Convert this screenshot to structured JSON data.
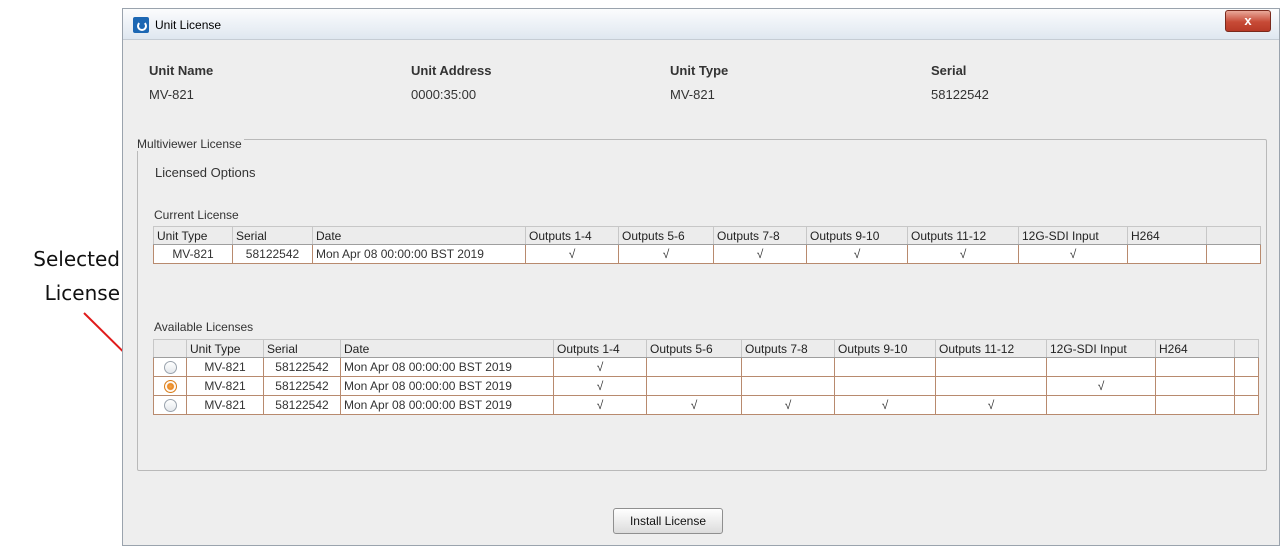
{
  "callout": {
    "line1": "Selected",
    "line2": "License"
  },
  "window": {
    "title": "Unit License",
    "close_label": "x"
  },
  "unit_info": {
    "name_label": "Unit Name",
    "name_value": "MV-821",
    "address_label": "Unit Address",
    "address_value": "0000:35:00",
    "type_label": "Unit Type",
    "type_value": "MV-821",
    "serial_label": "Serial",
    "serial_value": "58122542"
  },
  "multiviewer": {
    "group_label": "Multiviewer License",
    "licensed_options_label": "Licensed Options",
    "current_license_label": "Current License",
    "available_licenses_label": "Available Licenses"
  },
  "current_table": {
    "headers": [
      "Unit Type",
      "Serial",
      "Date",
      "Outputs 1-4",
      "Outputs 5-6",
      "Outputs 7-8",
      "Outputs 9-10",
      "Outputs 11-12",
      "12G-SDI Input",
      "H264",
      ""
    ],
    "rows": [
      [
        "MV-821",
        "58122542",
        "Mon Apr 08 00:00:00 BST 2019",
        "√",
        "√",
        "√",
        "√",
        "√",
        "√",
        "",
        ""
      ]
    ]
  },
  "available_table": {
    "headers": [
      "",
      "Unit Type",
      "Serial",
      "Date",
      "Outputs 1-4",
      "Outputs 5-6",
      "Outputs 7-8",
      "Outputs 9-10",
      "Outputs 11-12",
      "12G-SDI Input",
      "H264",
      ""
    ],
    "rows": [
      {
        "selected": false,
        "cells": [
          "MV-821",
          "58122542",
          "Mon Apr 08 00:00:00 BST 2019",
          "√",
          "",
          "",
          "",
          "",
          "",
          "",
          ""
        ]
      },
      {
        "selected": true,
        "cells": [
          "MV-821",
          "58122542",
          "Mon Apr 08 00:00:00 BST 2019",
          "√",
          "",
          "",
          "",
          "",
          "√",
          "",
          ""
        ]
      },
      {
        "selected": false,
        "cells": [
          "MV-821",
          "58122542",
          "Mon Apr 08 00:00:00 BST 2019",
          "√",
          "√",
          "√",
          "√",
          "√",
          "",
          "",
          ""
        ]
      }
    ]
  },
  "install_button": "Install License",
  "colors": {
    "callout_line": "#e01b1b",
    "row_border": "#b88a6e",
    "selected_radio": "#e8861f"
  }
}
